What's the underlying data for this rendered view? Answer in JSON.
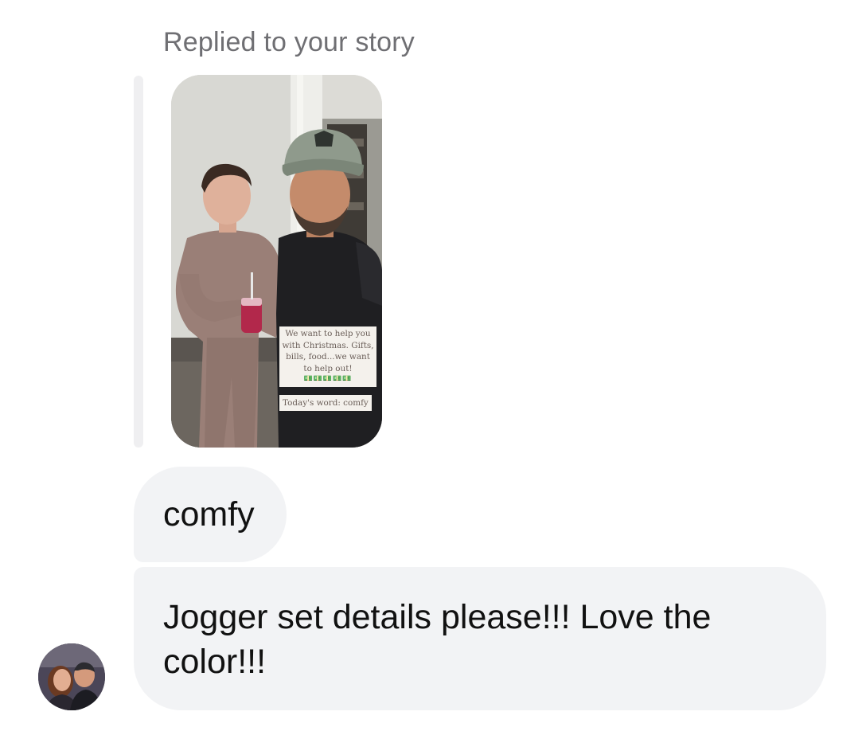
{
  "thread": {
    "reply_context": "Replied to your story"
  },
  "story": {
    "caption": "We want to help you with Christmas. Gifts, bills, food...we want to help out!",
    "emoji_row": "💵💵💵💵💵",
    "todays_word": "Today's word: comfy"
  },
  "messages": [
    {
      "text": "comfy"
    },
    {
      "text": "Jogger set details please!!! Love the color!!!"
    }
  ],
  "colors": {
    "bubble_bg": "#f2f3f5",
    "label_gray": "#6f6f73",
    "quote_bar": "#efeff1"
  },
  "icons": {
    "sender_avatar": "avatar-photo"
  }
}
